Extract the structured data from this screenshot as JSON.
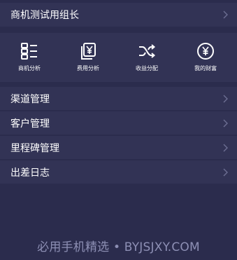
{
  "header": {
    "title": "商机测试用组长"
  },
  "quick_actions": [
    {
      "label": "商机分析",
      "icon": "list-icon"
    },
    {
      "label": "费用分析",
      "icon": "yen-document-icon"
    },
    {
      "label": "收益分配",
      "icon": "shuffle-icon"
    },
    {
      "label": "我的财富",
      "icon": "yen-circle-icon"
    }
  ],
  "menu": [
    {
      "label": "渠道管理"
    },
    {
      "label": "客户管理"
    },
    {
      "label": "里程碑管理"
    },
    {
      "label": "出差日志"
    }
  ],
  "watermark": "必用手机精选 • BYJSJXY.COM",
  "colors": {
    "background": "#2b2c4d",
    "row": "#323355",
    "text": "#ffffff",
    "chevron": "#6d6f93"
  }
}
